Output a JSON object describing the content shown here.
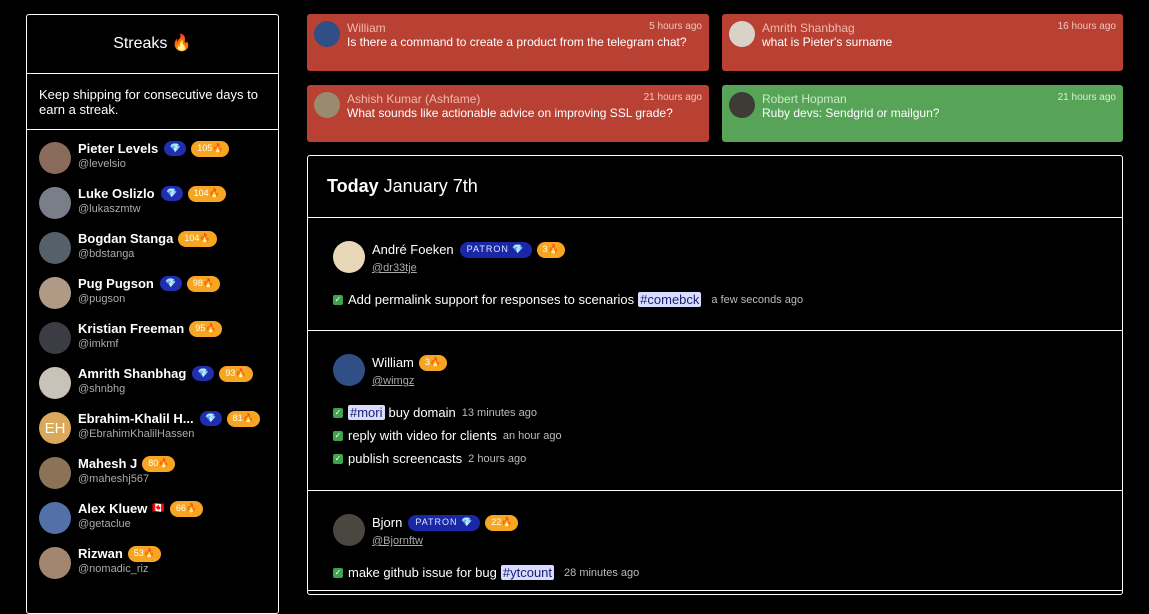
{
  "sidebar": {
    "title": "Streaks",
    "title_emoji": "🔥",
    "description": "Keep shipping for consecutive days to earn a streak.",
    "users": [
      {
        "name": "Pieter Levels",
        "handle": "@levelsio",
        "gem": "💎",
        "streak": "105🔥",
        "avatar": "#8a6a5a"
      },
      {
        "name": "Luke Oslizlo",
        "handle": "@lukaszmtw",
        "gem": "💎",
        "streak": "104🔥",
        "avatar": "#7a7e88"
      },
      {
        "name": "Bogdan Stanga",
        "handle": "@bdstanga",
        "gem": "",
        "streak": "104🔥",
        "avatar": "#55606a"
      },
      {
        "name": "Pug Pugson",
        "handle": "@pugson",
        "gem": "💎",
        "streak": "98🔥",
        "avatar": "#b09a86"
      },
      {
        "name": "Kristian Freeman",
        "handle": "@imkmf",
        "gem": "",
        "streak": "95🔥",
        "avatar": "#3c3c44"
      },
      {
        "name": "Amrith Shanbhag",
        "handle": "@shnbhg",
        "gem": "💎",
        "streak": "93🔥",
        "avatar": "#c8c2b8"
      },
      {
        "name": "Ebrahim-Khalil H...",
        "handle": "@EbrahimKhalilHassen",
        "gem": "💎",
        "streak": "81🔥",
        "avatar": "#d9a85a",
        "initials": "EH"
      },
      {
        "name": "Mahesh J",
        "handle": "@maheshj567",
        "gem": "",
        "streak": "80🔥",
        "avatar": "#8c7358"
      },
      {
        "name": "Alex Kluew",
        "handle": "@getaclue",
        "gem": "",
        "flag": "🇨🇦",
        "streak": "66🔥",
        "avatar": "#5470a8"
      },
      {
        "name": "Rizwan",
        "handle": "@nomadic_riz",
        "gem": "",
        "streak": "53🔥",
        "avatar": "#a38670"
      }
    ]
  },
  "messages": [
    {
      "author": "William",
      "time": "5 hours ago",
      "text": "Is there a command to create a product from the telegram chat?",
      "color": "red",
      "avatar": "#2f4f86"
    },
    {
      "author": "Amrith Shanbhag",
      "time": "16 hours ago",
      "text": "what is Pieter's surname",
      "color": "red",
      "avatar": "#d8d2c8"
    },
    {
      "author": "Ashish Kumar (Ashfame)",
      "time": "21 hours ago",
      "text": "What sounds like actionable advice on improving SSL grade?",
      "color": "red",
      "avatar": "#9a8a70"
    },
    {
      "author": "Robert Hopman",
      "time": "21 hours ago",
      "text": "Ruby devs: Sendgrid or mailgun?",
      "color": "green",
      "avatar": "#3e3a36"
    }
  ],
  "feed": {
    "day_label": "Today",
    "date": "January 7th",
    "entries": [
      {
        "name": "André Foeken",
        "handle": "@dr33tje",
        "patron": "PATRON 💎",
        "streak": "3🔥",
        "avatar": "#e8d8b8",
        "tasks": [
          {
            "pre": "Add permalink support for responses to scenarios",
            "tag": "#comebck",
            "post": "",
            "ago": "a few seconds ago"
          }
        ]
      },
      {
        "name": "William",
        "handle": "@wimgz",
        "patron": "",
        "streak": "3🔥",
        "avatar": "#2f4f86",
        "tasks": [
          {
            "pre": "",
            "tag": "#mori",
            "post": "buy domain",
            "ago": "13 minutes ago"
          },
          {
            "pre": "reply with video for clients",
            "tag": "",
            "post": "",
            "ago": "an hour ago"
          },
          {
            "pre": "publish screencasts",
            "tag": "",
            "post": "",
            "ago": "2 hours ago"
          }
        ]
      },
      {
        "name": "Bjorn",
        "handle": "@Bjornftw",
        "patron": "PATRON 💎",
        "streak": "22🔥",
        "avatar": "#4a4640",
        "tasks": [
          {
            "pre": "make github issue for bug",
            "tag": "#ytcount",
            "post": "",
            "ago": "28 minutes ago"
          }
        ]
      }
    ]
  }
}
